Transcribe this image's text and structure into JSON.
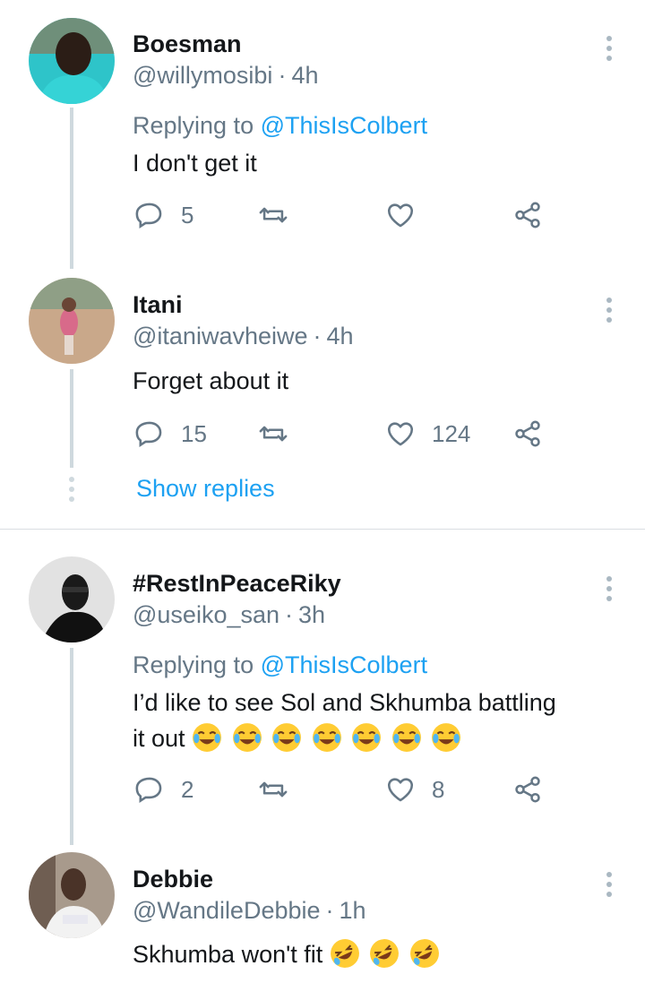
{
  "tweets": [
    {
      "name": "Boesman",
      "handle": "@willymosibi",
      "time": "4h",
      "replying_prefix": "Replying to",
      "replying_to": "@ThisIsColbert",
      "text": "I don't get it",
      "replies": "5",
      "retweets": "",
      "likes": "",
      "avatar_color": "#2ec4c9"
    },
    {
      "name": "Itani",
      "handle": "@itaniwavheiwe",
      "time": "4h",
      "text": "Forget about it",
      "replies": "15",
      "retweets": "",
      "likes": "124",
      "show_replies": "Show replies",
      "avatar_color": "#b07a52"
    },
    {
      "name": "#RestInPeaceRiky",
      "handle": "@useiko_san",
      "time": "3h",
      "replying_prefix": "Replying to",
      "replying_to": "@ThisIsColbert",
      "text_line1": "I’d like to see Sol and Skhumba battling",
      "text_line2": "it out",
      "emoji_count": "7",
      "emoji_name": "face-with-tears-of-joy",
      "replies": "2",
      "retweets": "",
      "likes": "8",
      "avatar_color": "#d8d8d8"
    },
    {
      "name": "Debbie",
      "handle": "@WandileDebbie",
      "time": "1h",
      "text": "Skhumba won't fit",
      "emoji_count": "3",
      "emoji_name": "rolling-on-the-floor-laughing",
      "avatar_color": "#8c7a6a"
    }
  ],
  "icons": {
    "reply": "reply-icon",
    "retweet": "retweet-icon",
    "like": "heart-icon",
    "share": "share-icon",
    "more": "more-options-icon"
  },
  "colors": {
    "link": "#1da1f2",
    "secondary_text": "#657786",
    "thread_line": "#cfd9de"
  }
}
